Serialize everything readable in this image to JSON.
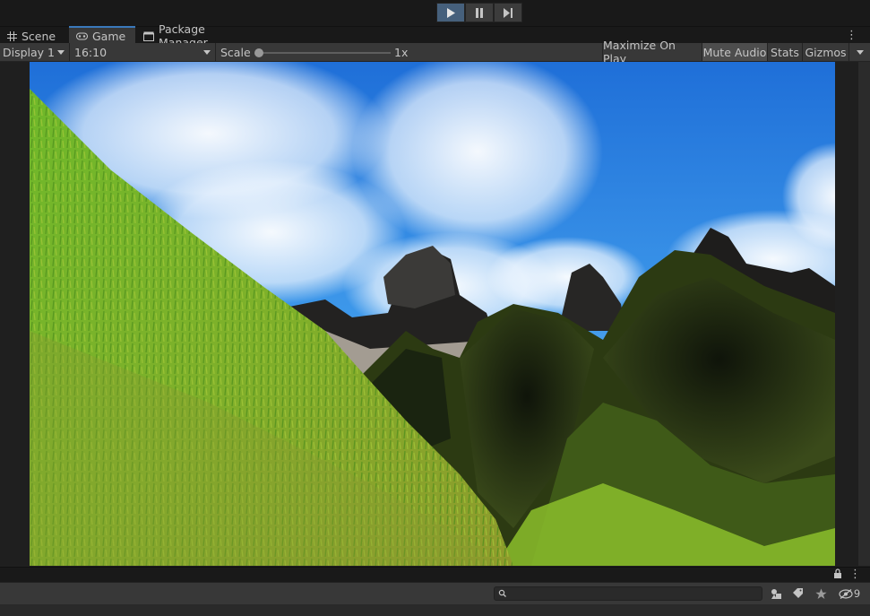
{
  "play_toolbar": {
    "buttons": [
      {
        "name": "play",
        "icon": "play-icon",
        "active": true
      },
      {
        "name": "pause",
        "icon": "pause-icon",
        "active": false
      },
      {
        "name": "step",
        "icon": "step-icon",
        "active": false
      }
    ]
  },
  "tabs": [
    {
      "label": "Scene",
      "icon": "grid-icon",
      "active": false
    },
    {
      "label": "Game",
      "icon": "gamepad-icon",
      "active": true
    },
    {
      "label": "Package Manager",
      "icon": "package-icon",
      "active": false
    }
  ],
  "game_toolbar": {
    "display": "Display 1",
    "aspect": "16:10",
    "scale_label": "Scale",
    "scale_value": "1x",
    "scale_fraction": 0.0,
    "maximize_on_play": "Maximize On Play",
    "mute_audio": "Mute Audio",
    "stats": "Stats",
    "gizmos": "Gizmos"
  },
  "bottom_panel": {
    "search_placeholder": "",
    "hidden_count": "9"
  },
  "colors": {
    "accent": "#3a79bb",
    "play_active": "#46607c",
    "panel": "#383838",
    "background": "#191919"
  }
}
